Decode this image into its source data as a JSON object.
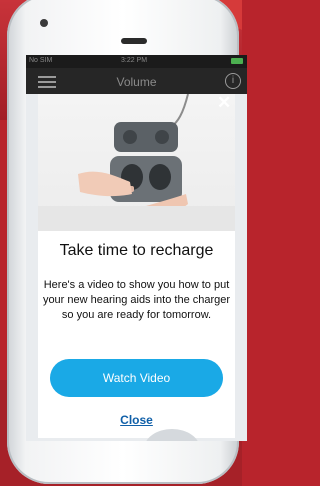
{
  "status_bar": {
    "carrier": "No SIM",
    "time": "3:22 PM"
  },
  "nav": {
    "title": "Volume",
    "menu_icon": "hamburger-icon",
    "info_icon": "info-icon"
  },
  "modal": {
    "close_icon": "close-icon",
    "title": "Take time to recharge",
    "body": "Here's a video to show you how to put your new hearing aids into the charger so you are ready for tomorrow.",
    "watch_button": "Watch Video",
    "close_link": "Close"
  },
  "colors": {
    "accent": "#1aa9e6",
    "link": "#0f5fa8",
    "nav_bg": "#262626"
  }
}
